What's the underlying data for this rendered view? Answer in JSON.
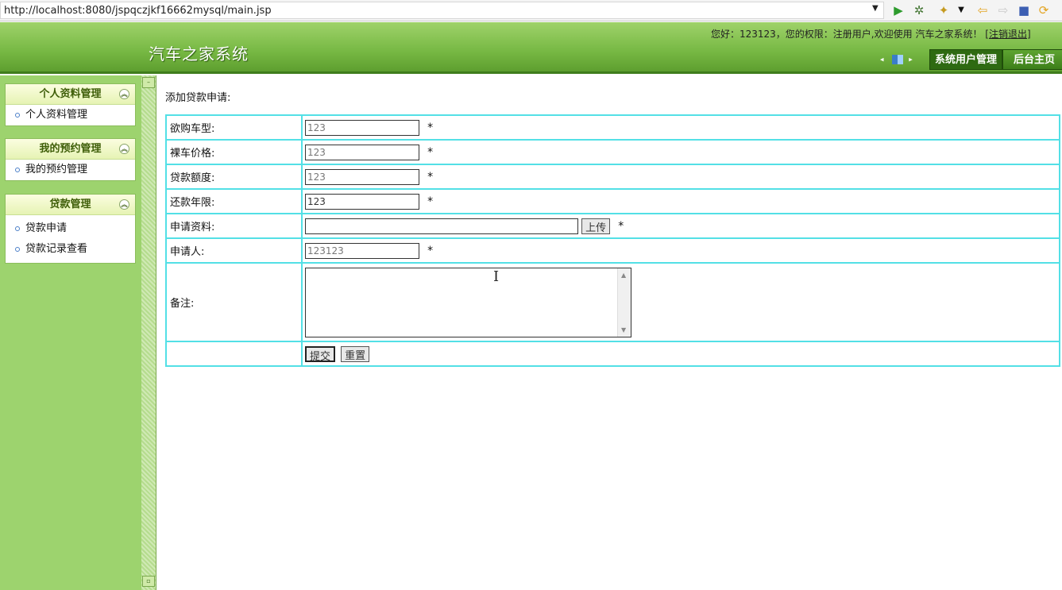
{
  "browser": {
    "url": "http://localhost:8080/jspqczjkf16662mysql/main.jsp",
    "icons": [
      "run-icon",
      "debug-icon",
      "tools-icon",
      "dropdown-icon",
      "back-icon",
      "forward-icon",
      "stop-icon",
      "refresh-icon"
    ]
  },
  "header": {
    "title": "汽车之家系统",
    "greeting": "您好：123123，您的权限：注册用户,欢迎使用 汽车之家系统！",
    "logout": "[注销退出]",
    "tabs": [
      "系统用户管理",
      "后台主页"
    ]
  },
  "sidebar": {
    "groups": [
      {
        "title": "个人资料管理",
        "items": [
          "个人资料管理"
        ]
      },
      {
        "title": "我的预约管理",
        "items": [
          "我的预约管理"
        ]
      },
      {
        "title": "贷款管理",
        "items": [
          "贷款申请",
          "贷款记录查看"
        ]
      }
    ]
  },
  "form": {
    "page_title": "添加贷款申请:",
    "required_mark": "*",
    "fields": {
      "car_type": {
        "label": "欲购车型:",
        "value": "123"
      },
      "price": {
        "label": "裸车价格:",
        "value": "123"
      },
      "loan_amount": {
        "label": "贷款额度:",
        "value": "123"
      },
      "term": {
        "label": "还款年限:",
        "value": "123"
      },
      "material": {
        "label": "申请资料:",
        "value": "",
        "upload_label": "上传"
      },
      "applicant": {
        "label": "申请人:",
        "value": "123123"
      },
      "remark": {
        "label": "备注:",
        "value": ""
      }
    },
    "submit_label": "提交",
    "reset_label": "重置"
  }
}
